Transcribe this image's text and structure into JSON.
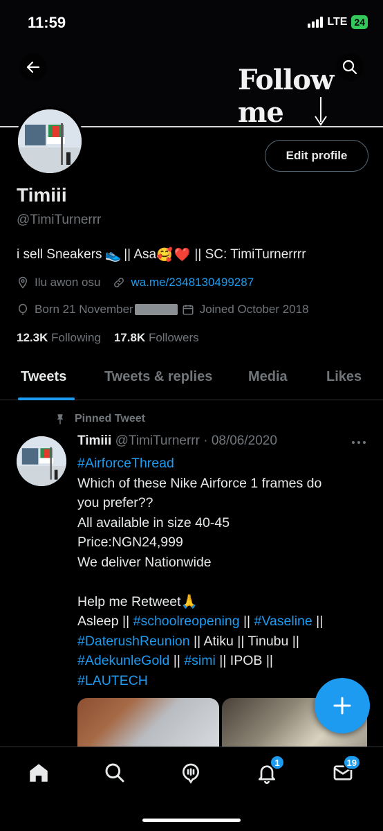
{
  "status_bar": {
    "time": "11:59",
    "network": "LTE",
    "battery": "24"
  },
  "banner": {
    "text": "Follow me"
  },
  "header": {
    "back_icon": "arrow-left-icon",
    "search_icon": "search-icon"
  },
  "profile": {
    "edit_label": "Edit profile",
    "name": "Timiii",
    "handle": "@TimiTurnerrr",
    "bio": {
      "part1": "i sell Sneakers",
      "sneaker_emoji": "👟",
      "part2": "|| Asa",
      "smile_emoji": "🥰",
      "heart_emoji": "❤️",
      "part3": "|| SC: TimiTurnerrrr"
    },
    "location": "Ilu awon osu",
    "link": "wa.me/2348130499287",
    "born": "Born 21 November",
    "joined": "Joined October 2018",
    "following_count": "12.3K",
    "following_label": "Following",
    "followers_count": "17.8K",
    "followers_label": "Followers"
  },
  "tabs": [
    {
      "label": "Tweets",
      "active": true
    },
    {
      "label": "Tweets & replies",
      "active": false
    },
    {
      "label": "Media",
      "active": false
    },
    {
      "label": "Likes",
      "active": false
    }
  ],
  "tweet": {
    "pinned_label": "Pinned Tweet",
    "name": "Timiii",
    "meta": "@TimiTurnerrr · 08/06/2020",
    "hashtag_title": "#AirforceThread",
    "line1": "Which of these Nike Airforce 1 frames do",
    "line2": "you prefer??",
    "line3": "All available in size 40-45",
    "line4": "Price:NGN24,999",
    "line5": "We deliver Nationwide",
    "line6": "Help me Retweet",
    "pray_emoji": "🙏",
    "l7a": "Asleep || ",
    "l7b": "#schoolreopening",
    "l7c": " || ",
    "l7d": "#Vaseline",
    "l7e": " ||",
    "l8a": "#DaterushReunion",
    "l8b": " || Atiku || Tinubu ||",
    "l9a": "#AdekunleGold",
    "l9b": " || ",
    "l9c": "#simi",
    "l9d": " || IPOB ||",
    "l10": "#LAUTECH"
  },
  "bottom_nav": {
    "items": [
      "home-icon",
      "search-icon",
      "spaces-icon",
      "notifications-icon",
      "messages-icon"
    ],
    "notifications_badge": "1",
    "messages_badge": "19"
  },
  "colors": {
    "accent": "#1d9bf0",
    "background": "#000000",
    "muted": "#71767b"
  }
}
